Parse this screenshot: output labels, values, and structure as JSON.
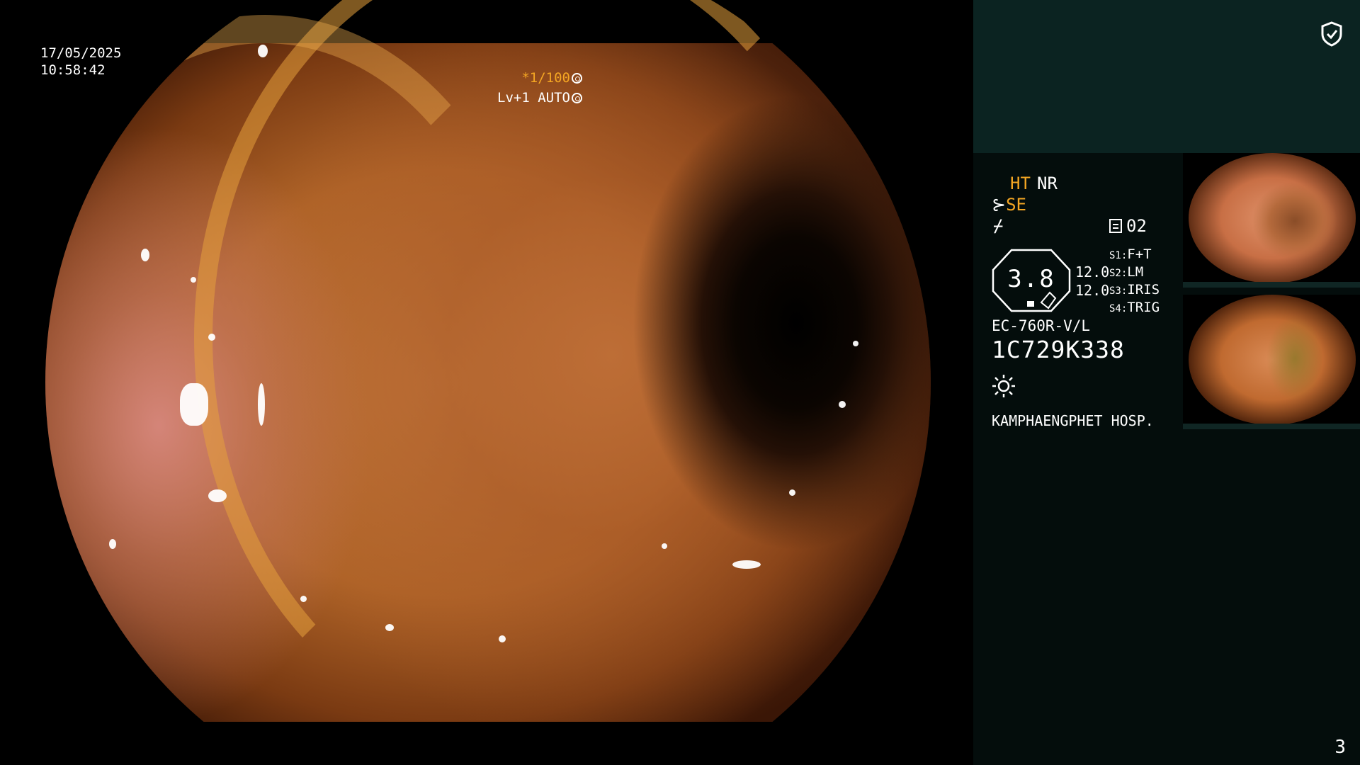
{
  "scope_view": {
    "date": "17/05/2025",
    "time": "10:58:42",
    "shutter_prefix": "*",
    "shutter_value": "1/100",
    "level_auto": "Lv+1 AUTO"
  },
  "panel": {
    "mode_ht": "HT",
    "mode_nr": "NR",
    "se_label": "SE",
    "freeze_symbol": "⌿",
    "slot_label": "02",
    "zoom_value": "3.8",
    "value_a": "12.0",
    "value_b": "12.0",
    "switches": [
      {
        "id": "S1",
        "label": "F+T"
      },
      {
        "id": "S2",
        "label": "LM"
      },
      {
        "id": "S3",
        "label": "IRIS"
      },
      {
        "id": "S4",
        "label": "TRIG"
      }
    ],
    "scope_model": "EC-760R-V/L",
    "scope_serial": "1C729K338",
    "hospital": "KAMPHAENGPHET HOSP.",
    "page_number": "3"
  },
  "icons": {
    "shield": "shield-check-icon",
    "gear": "gear-icon",
    "brightness": "brightness-icon",
    "scope": "scope-icon"
  },
  "colors": {
    "panel_background": "#040d0c",
    "panel_header": "#0b2321",
    "accent": "#f4a623"
  }
}
